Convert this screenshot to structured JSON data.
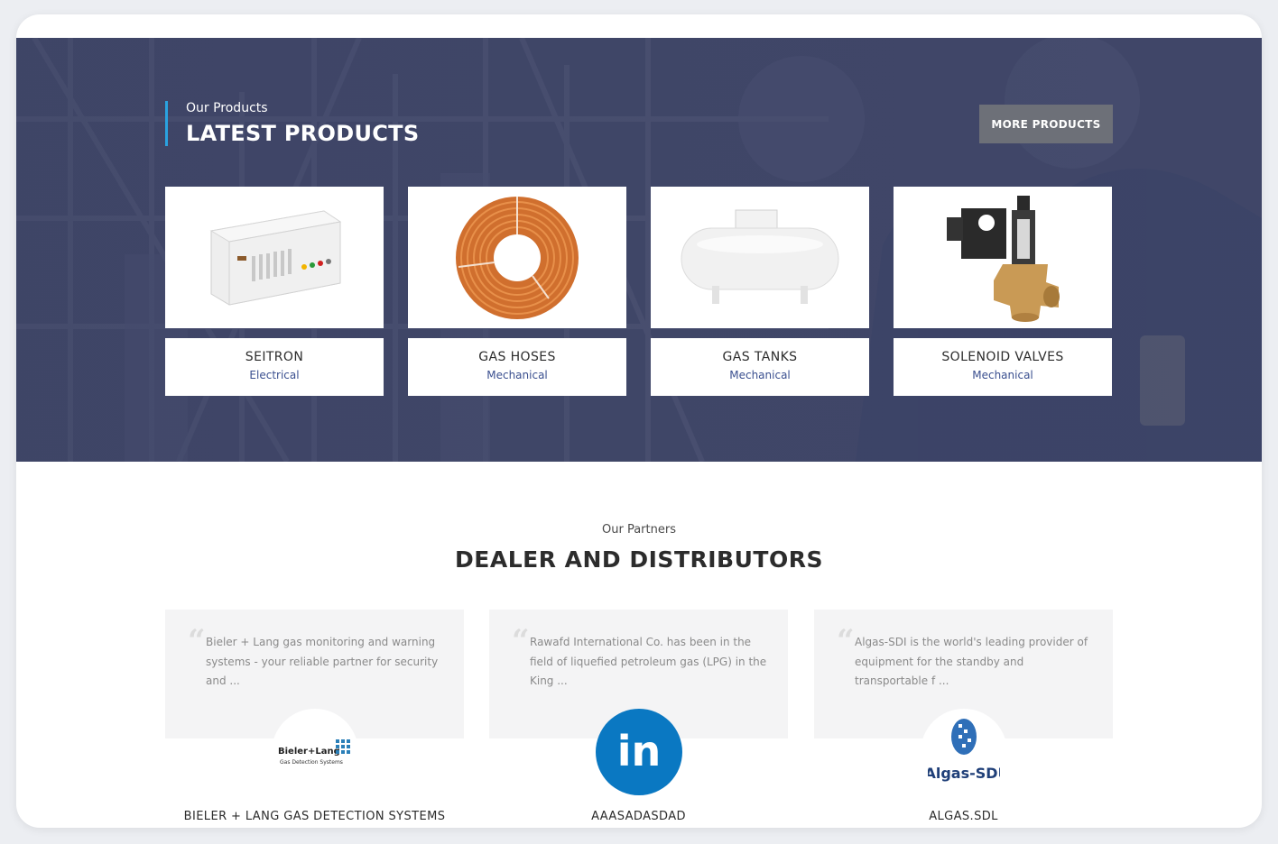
{
  "hero": {
    "eyebrow": "Our Products",
    "title": "LATEST PRODUCTS",
    "more_button": "MORE PRODUCTS"
  },
  "products": [
    {
      "name": "SEITRON",
      "category": "Electrical",
      "icon": "gas-detector-panel-image"
    },
    {
      "name": "GAS HOSES",
      "category": "Mechanical",
      "icon": "gas-hose-coil-image"
    },
    {
      "name": "GAS TANKS",
      "category": "Mechanical",
      "icon": "gas-tank-image"
    },
    {
      "name": "SOLENOID VALVES",
      "category": "Mechanical",
      "icon": "solenoid-valve-image"
    }
  ],
  "partners": {
    "eyebrow": "Our Partners",
    "title": "DEALER AND DISTRIBUTORS",
    "items": [
      {
        "description": "Bieler + Lang gas monitoring and warning systems - your reliable partner for security and ...",
        "name": "BIELER + LANG GAS DETECTION SYSTEMS",
        "logo_text": "Bieler+Lang",
        "logo_subtext": "Gas Detection Systems"
      },
      {
        "description": "Rawafd International Co. has been in the field of liquefied petroleum gas (LPG) in the King ...",
        "name": "AAASADASDAD",
        "logo_text": "in"
      },
      {
        "description": "Algas-SDI is the world's leading provider of equipment for the standby and transportable f ...",
        "name": "ALGAS.SDL",
        "logo_text": "Algas-SDI"
      }
    ]
  },
  "colors": {
    "hero_bg": "#3b4260",
    "accent_line": "#2aa2e0",
    "button_bg": "#6d7078",
    "category": "#3a4f8f",
    "linkedin": "#0a78c2"
  }
}
